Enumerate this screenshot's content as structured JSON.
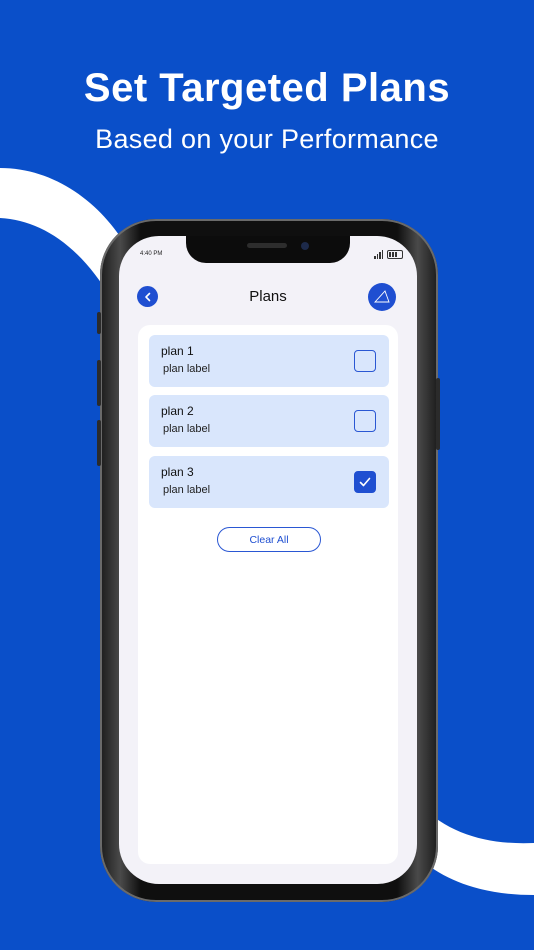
{
  "promo": {
    "headline": "Set Targeted Plans",
    "subline": "Based on your Performance"
  },
  "colors": {
    "background": "#0a4fc9",
    "accent": "#1f4fd1",
    "plan_item_bg": "#d9e6fc",
    "screen_bg": "#f3f2f8"
  },
  "status_bar": {
    "time": "4:40 PM"
  },
  "header": {
    "title": "Plans",
    "back_icon": "chevron-left-icon",
    "avatar_icon": "triangle-logo-icon"
  },
  "plans": [
    {
      "title": "plan 1",
      "label": "plan label",
      "checked": false
    },
    {
      "title": "plan 2",
      "label": "plan label",
      "checked": false
    },
    {
      "title": "plan 3",
      "label": "plan label",
      "checked": true
    }
  ],
  "actions": {
    "clear_all_label": "Clear All"
  }
}
